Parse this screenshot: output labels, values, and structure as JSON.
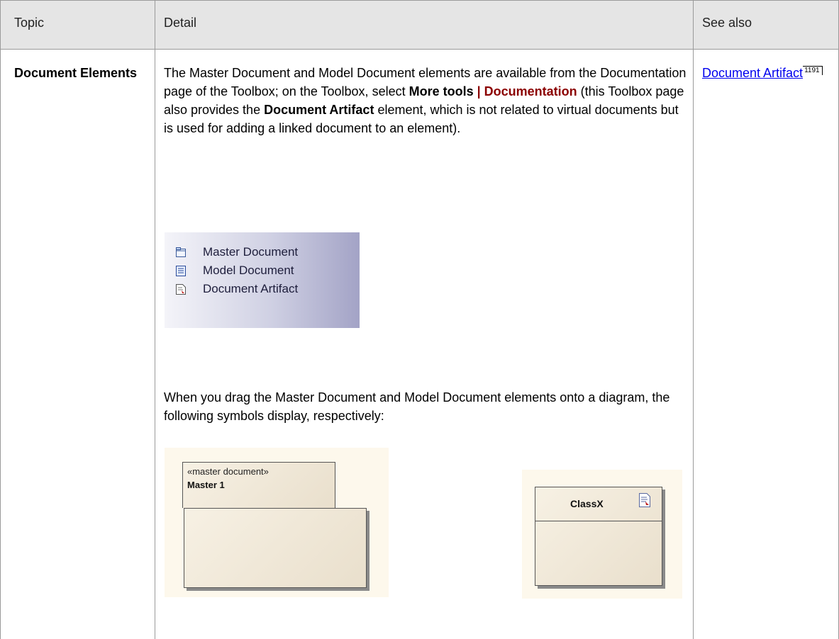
{
  "header": {
    "topic": "Topic",
    "detail": "Detail",
    "see_also": "See also"
  },
  "row": {
    "topic": "Document Elements",
    "detail_p1_a": "The Master Document and Model Document elements are available from the Documentation page of the Toolbox; on the Toolbox, select ",
    "detail_p1_menu_a": "More tools",
    "detail_p1_menu_sep": " | ",
    "detail_p1_menu_b": "Documentation",
    "detail_p1_b": " (this Toolbox page also provides the ",
    "detail_p1_bold": "Document Artifact",
    "detail_p1_c": " element, which is not related to virtual documents but is used for adding a linked document to an element).",
    "toolbox_items": [
      {
        "label": "Master Document",
        "icon": "master-document-icon"
      },
      {
        "label": "Model Document",
        "icon": "model-document-icon"
      },
      {
        "label": "Document Artifact",
        "icon": "document-artifact-icon"
      }
    ],
    "detail_p2": "When you drag the Master Document and Model Document elements onto a diagram, the following symbols display, respectively:",
    "diagram_master": {
      "stereotype": "«master document»",
      "name": "Master 1"
    },
    "diagram_model": {
      "name": "ClassX",
      "icon": "linked-document-icon"
    },
    "see_also_link": "Document Artifact",
    "see_also_page": "1191"
  }
}
